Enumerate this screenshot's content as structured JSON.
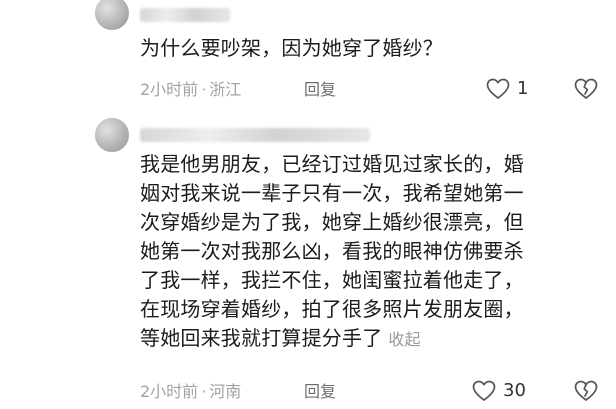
{
  "comments": [
    {
      "username": "",
      "text_lines": [
        "为什么要吵架，因为她穿了婚纱？"
      ],
      "time": "2小时前",
      "location": "浙江",
      "reply_label": "回复",
      "like_count": "1",
      "fold_label": "",
      "icons": {
        "like": "heart-outline-icon",
        "dislike": "broken-heart-icon"
      }
    },
    {
      "username": "",
      "text_lines": [
        "我是他男朋友，已经订过婚见过家长的，婚",
        "姻对我来说一辈子只有一次，我希望她第一",
        "次穿婚纱是为了我，她穿上婚纱很漂亮，但",
        "她第一次对我那么凶，看我的眼神仿佛要杀",
        "了我一样，我拦不住，她闺蜜拉着他走了，",
        "在现场穿着婚纱，拍了很多照片发朋友圈，",
        "等她回来我就打算提分手了"
      ],
      "time": "2小时前",
      "location": "河南",
      "reply_label": "回复",
      "like_count": "30",
      "fold_label": "收起",
      "icons": {
        "like": "heart-outline-icon",
        "dislike": "broken-heart-icon"
      }
    }
  ],
  "colors": {
    "text": "#1c1c1c",
    "meta": "#a3a3a3",
    "reply": "#6f6f6f",
    "icon": "#555555"
  }
}
